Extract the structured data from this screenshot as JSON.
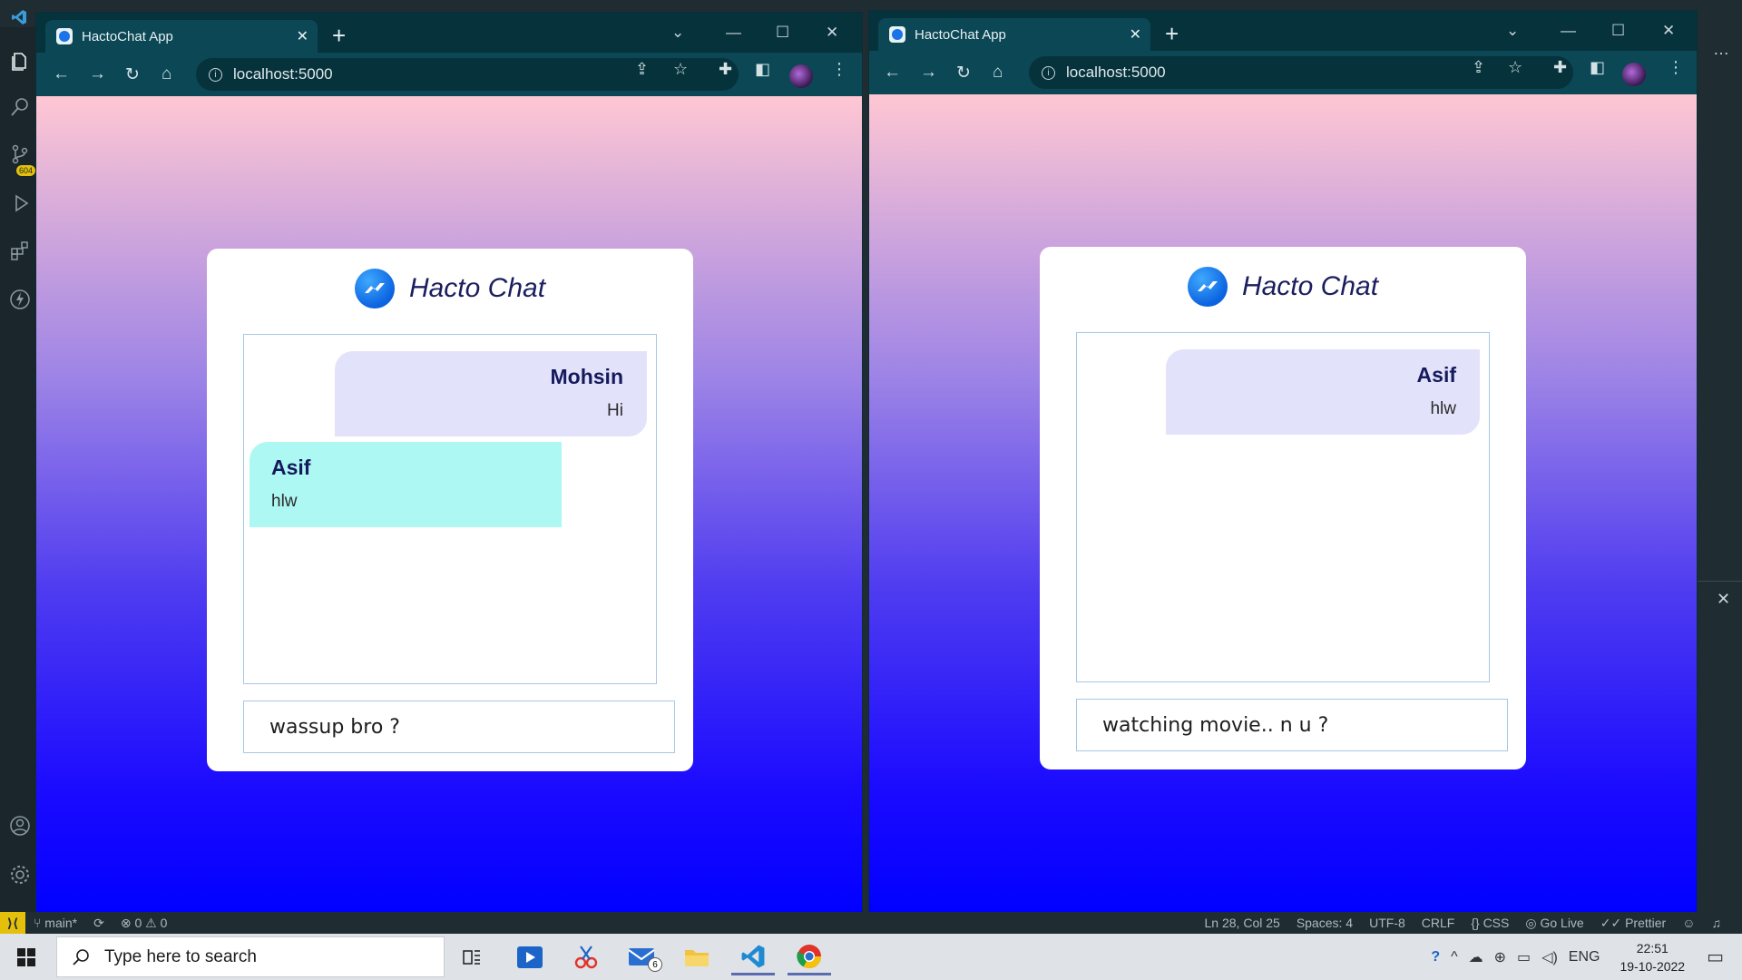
{
  "vscode": {
    "status": {
      "branch": "main*",
      "problems": "⊗ 0 ⚠ 0",
      "position": "Ln 28, Col 25",
      "spaces": "Spaces: 4",
      "encoding": "UTF-8",
      "eol": "CRLF",
      "language": "CSS",
      "golive": "Go Live",
      "prettier": "Prettier"
    },
    "badge": "604"
  },
  "left_window": {
    "tab_title": "HactoChat App",
    "url": "localhost:5000",
    "app_title": "Hacto Chat",
    "messages": [
      {
        "name": "Mohsin",
        "text": "Hi",
        "side": "mine"
      },
      {
        "name": "Asif",
        "text": "hlw",
        "side": "theirs"
      }
    ],
    "input_value": "wassup bro ?"
  },
  "right_window": {
    "tab_title": "HactoChat App",
    "url": "localhost:5000",
    "app_title": "Hacto Chat",
    "messages": [
      {
        "name": "Asif",
        "text": "hlw",
        "side": "mine"
      }
    ],
    "input_value": "watching movie.. n u ?"
  },
  "taskbar": {
    "search_placeholder": "Type here to search",
    "mail_badge": "6",
    "language": "ENG",
    "time": "22:51",
    "date": "19-10-2022"
  },
  "colors": {
    "accent": "#0b4755",
    "gradient_top": "#ffc7d3",
    "gradient_bottom": "#0000ff",
    "bubble_mine": "#e3e2fb",
    "bubble_theirs": "#adf8f2"
  }
}
